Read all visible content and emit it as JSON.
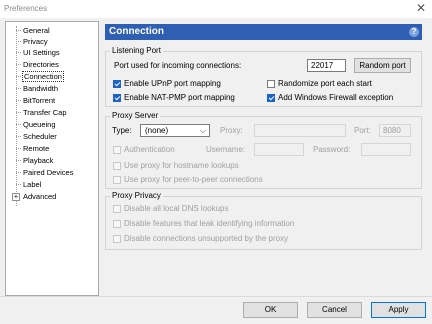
{
  "window": {
    "title": "Preferences",
    "close_symbol": "✕"
  },
  "sidebar": {
    "items": [
      {
        "label": "General"
      },
      {
        "label": "Privacy"
      },
      {
        "label": "UI Settings"
      },
      {
        "label": "Directories"
      },
      {
        "label": "Connection",
        "selected": true
      },
      {
        "label": "Bandwidth"
      },
      {
        "label": "BitTorrent"
      },
      {
        "label": "Transfer Cap"
      },
      {
        "label": "Queueing"
      },
      {
        "label": "Scheduler"
      },
      {
        "label": "Remote"
      },
      {
        "label": "Playback"
      },
      {
        "label": "Paired Devices"
      },
      {
        "label": "Label"
      },
      {
        "label": "Advanced",
        "expander": "+"
      }
    ]
  },
  "header": {
    "title": "Connection",
    "help_symbol": "?"
  },
  "listening_port": {
    "title": "Listening Port",
    "port_label": "Port used for incoming connections:",
    "port_value": "22017",
    "random_port_button": "Random port",
    "upnp": {
      "label": "Enable UPnP port mapping",
      "checked": true
    },
    "randomize": {
      "label": "Randomize port each start",
      "checked": false
    },
    "natpmp": {
      "label": "Enable NAT-PMP port mapping",
      "checked": true
    },
    "firewall": {
      "label": "Add Windows Firewall exception",
      "checked": true
    }
  },
  "proxy_server": {
    "title": "Proxy Server",
    "type_label": "Type:",
    "type_value": "(none)",
    "proxy_label": "Proxy:",
    "proxy_value": "",
    "port_label": "Port:",
    "port_value": "8080",
    "auth_label": "Authentication",
    "username_label": "Username:",
    "password_label": "Password:",
    "hostname_lookup_label": "Use proxy for hostname lookups",
    "p2p_label": "Use proxy for peer-to-peer connections"
  },
  "proxy_privacy": {
    "title": "Proxy Privacy",
    "dns_label": "Disable all local DNS lookups",
    "leak_label": "Disable features that leak identifying information",
    "unsupported_label": "Disable connections unsupported by the proxy"
  },
  "footer": {
    "ok": "OK",
    "cancel": "Cancel",
    "apply": "Apply"
  },
  "colors": {
    "header_bg": "#2e5fb3",
    "check_on": "#1b63c9",
    "primary_border": "#0078d7"
  }
}
